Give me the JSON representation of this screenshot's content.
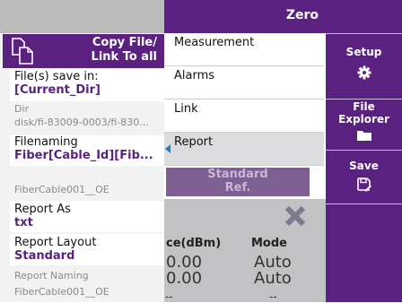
{
  "header": {
    "title": "Zero"
  },
  "left_panel": {
    "copy_button": {
      "label_line1": "Copy File/",
      "label_line2": "Link To all"
    },
    "save_in": {
      "label": "File(s) save in:",
      "value": "[Current_Dir]"
    },
    "dir": {
      "label": "Dir",
      "value": "disk/fi-83009-0003/fi-830..."
    },
    "filenaming": {
      "label": "Filenaming",
      "value": "Fiber[Cable_Id][Fib..."
    },
    "filenaming_preview": "FiberCable001__OE",
    "report_as": {
      "label": "Report As",
      "value": "txt"
    },
    "report_layout": {
      "label": "Report Layout",
      "value": "Standard"
    },
    "report_naming": {
      "label": "Report Naming",
      "value": "FiberCable001__OE"
    }
  },
  "menu": {
    "items": [
      "Measurement",
      "Alarms",
      "Link",
      "Report"
    ],
    "selected": "Report"
  },
  "background": {
    "std_ref_line1": "Standard",
    "std_ref_line2": "Ref.",
    "power_header": "ce(dBm)",
    "mode_header": "Mode",
    "power_values": [
      "0.00",
      "0.00"
    ],
    "mode_values": [
      "Auto",
      "Auto"
    ],
    "dash": "--"
  },
  "side_panel": {
    "setup_label": "Setup",
    "file_explorer_line1": "File",
    "file_explorer_line2": "Explorer",
    "save_label": "Save"
  },
  "colors": {
    "accent": "#5b2181",
    "selected_menu": "#dcdcde",
    "arrow": "#1e7fd0"
  }
}
